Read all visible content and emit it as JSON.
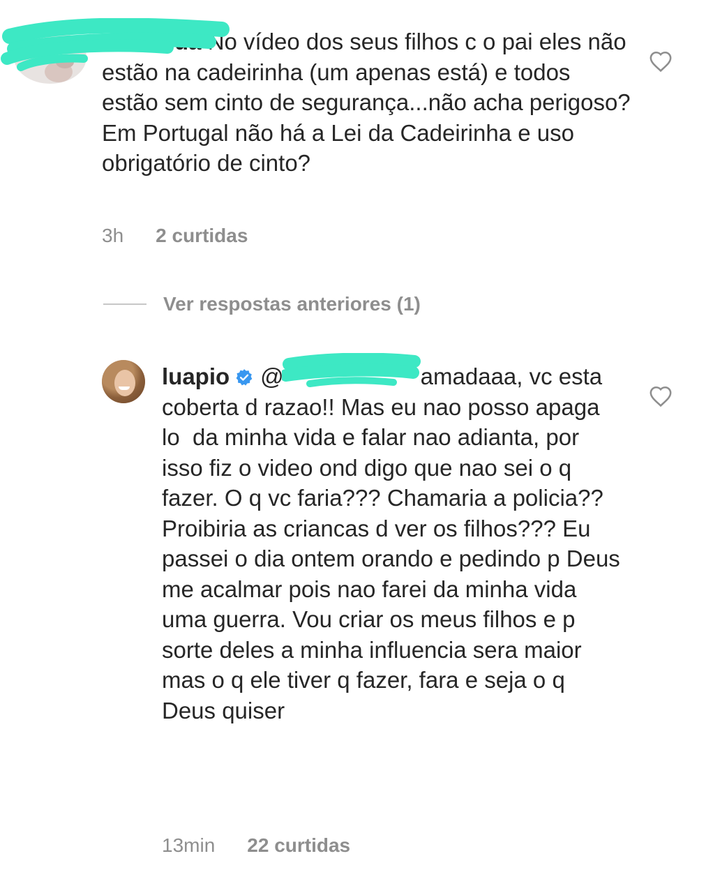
{
  "comments": [
    {
      "username_visible": "ua",
      "text": "No vídeo dos seus filhos c o pai eles não estão na cadeirinha (um apenas está) e todos estão sem cinto de segurança...não acha perigoso? Em Portugal não há a Lei da Cadeirinha e uso obrigatório de cinto?",
      "time": "3h",
      "likes": "2 curtidas"
    },
    {
      "username": "luapio",
      "mention_visible": "@",
      "text": "amadaaa, vc esta coberta d razao!! Mas eu nao posso apaga lo  da minha vida e falar nao adianta, por isso fiz o video ond digo que nao sei o q fazer. O q vc faria??? Chamaria a policia?? Proibiria as criancas d ver os filhos??? Eu passei o dia ontem orando e pedindo p Deus me acalmar pois nao farei da minha vida uma guerra. Vou criar os meus filhos e p sorte deles a minha influencia sera maior mas o q ele tiver q fazer, fara e seja o q Deus quiser",
      "time": "13min",
      "likes": "22 curtidas"
    }
  ],
  "view_replies": "Ver respostas anteriores (1)",
  "colors": {
    "text": "#262626",
    "meta": "#8e8e8e",
    "verified": "#3897f0",
    "scribble": "#3de8c4"
  },
  "icons": [
    "heart-icon",
    "verified-badge-icon"
  ]
}
